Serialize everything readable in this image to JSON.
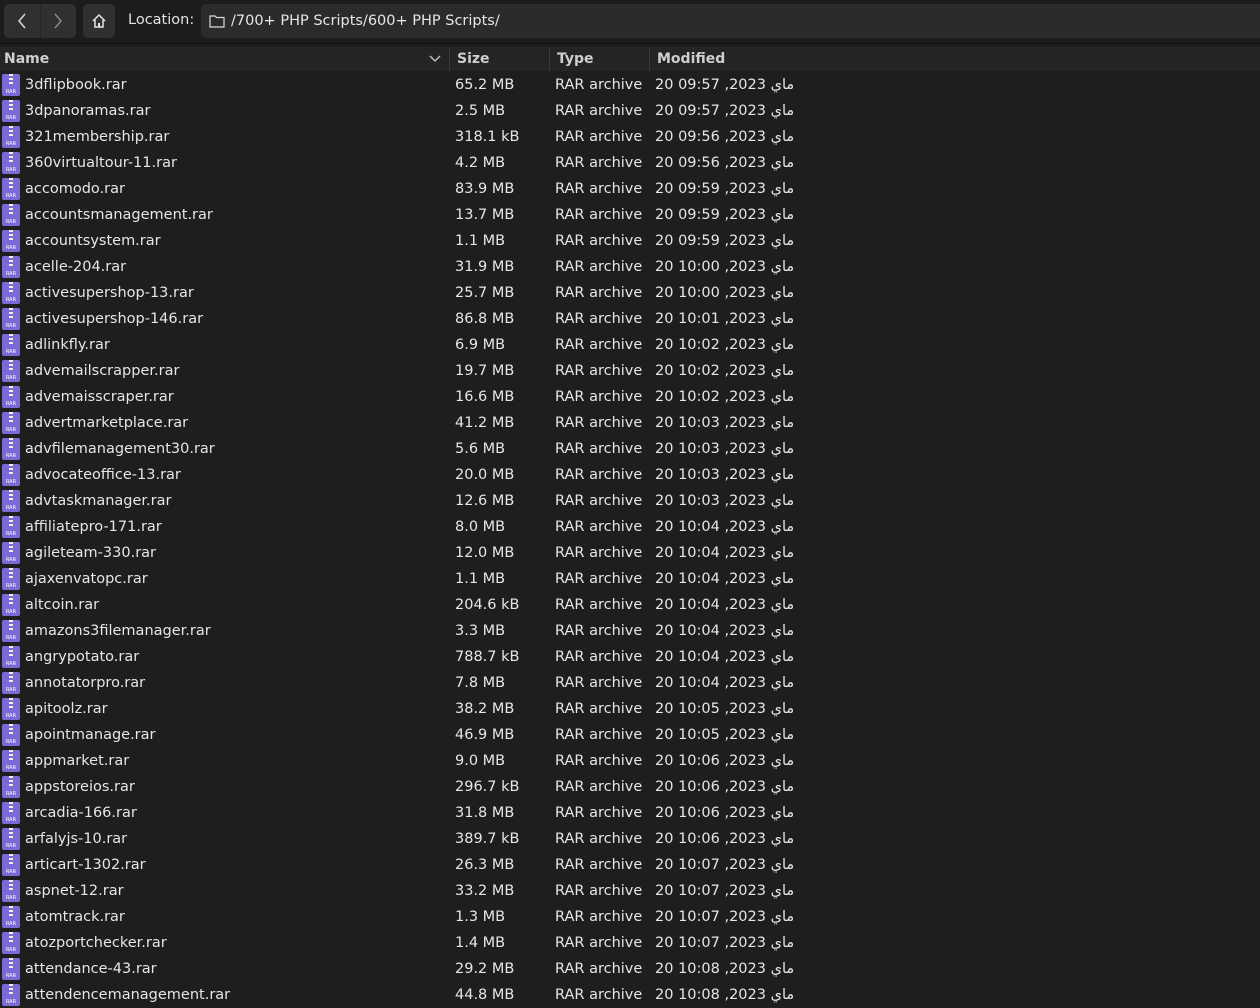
{
  "toolbar": {
    "back_icon": "chevron-left-icon",
    "forward_icon": "chevron-right-icon",
    "home_icon": "home-icon",
    "location_label": "Location:",
    "location_path": "/700+ PHP Scripts/600+ PHP Scripts/"
  },
  "columns": {
    "name": "Name",
    "size": "Size",
    "type": "Type",
    "modified": "Modified"
  },
  "colors": {
    "background": "#1e1e1e",
    "icon_rar": "#7a6ad6"
  },
  "files": [
    {
      "name": "3dflipbook.rar",
      "size": "65.2 MB",
      "type": "RAR archive",
      "modified": "20 ماي 2023, 09:57"
    },
    {
      "name": "3dpanoramas.rar",
      "size": "2.5 MB",
      "type": "RAR archive",
      "modified": "20 ماي 2023, 09:57"
    },
    {
      "name": "321membership.rar",
      "size": "318.1 kB",
      "type": "RAR archive",
      "modified": "20 ماي 2023, 09:56"
    },
    {
      "name": "360virtualtour-11.rar",
      "size": "4.2 MB",
      "type": "RAR archive",
      "modified": "20 ماي 2023, 09:56"
    },
    {
      "name": "accomodo.rar",
      "size": "83.9 MB",
      "type": "RAR archive",
      "modified": "20 ماي 2023, 09:59"
    },
    {
      "name": "accountsmanagement.rar",
      "size": "13.7 MB",
      "type": "RAR archive",
      "modified": "20 ماي 2023, 09:59"
    },
    {
      "name": "accountsystem.rar",
      "size": "1.1 MB",
      "type": "RAR archive",
      "modified": "20 ماي 2023, 09:59"
    },
    {
      "name": "acelle-204.rar",
      "size": "31.9 MB",
      "type": "RAR archive",
      "modified": "20 ماي 2023, 10:00"
    },
    {
      "name": "activesupershop-13.rar",
      "size": "25.7 MB",
      "type": "RAR archive",
      "modified": "20 ماي 2023, 10:00"
    },
    {
      "name": "activesupershop-146.rar",
      "size": "86.8 MB",
      "type": "RAR archive",
      "modified": "20 ماي 2023, 10:01"
    },
    {
      "name": "adlinkfly.rar",
      "size": "6.9 MB",
      "type": "RAR archive",
      "modified": "20 ماي 2023, 10:02"
    },
    {
      "name": "advemailscrapper.rar",
      "size": "19.7 MB",
      "type": "RAR archive",
      "modified": "20 ماي 2023, 10:02"
    },
    {
      "name": "advemaisscraper.rar",
      "size": "16.6 MB",
      "type": "RAR archive",
      "modified": "20 ماي 2023, 10:02"
    },
    {
      "name": "advertmarketplace.rar",
      "size": "41.2 MB",
      "type": "RAR archive",
      "modified": "20 ماي 2023, 10:03"
    },
    {
      "name": "advfilemanagement30.rar",
      "size": "5.6 MB",
      "type": "RAR archive",
      "modified": "20 ماي 2023, 10:03"
    },
    {
      "name": "advocateoffice-13.rar",
      "size": "20.0 MB",
      "type": "RAR archive",
      "modified": "20 ماي 2023, 10:03"
    },
    {
      "name": "advtaskmanager.rar",
      "size": "12.6 MB",
      "type": "RAR archive",
      "modified": "20 ماي 2023, 10:03"
    },
    {
      "name": "affiliatepro-171.rar",
      "size": "8.0 MB",
      "type": "RAR archive",
      "modified": "20 ماي 2023, 10:04"
    },
    {
      "name": "agileteam-330.rar",
      "size": "12.0 MB",
      "type": "RAR archive",
      "modified": "20 ماي 2023, 10:04"
    },
    {
      "name": "ajaxenvatopc.rar",
      "size": "1.1 MB",
      "type": "RAR archive",
      "modified": "20 ماي 2023, 10:04"
    },
    {
      "name": "altcoin.rar",
      "size": "204.6 kB",
      "type": "RAR archive",
      "modified": "20 ماي 2023, 10:04"
    },
    {
      "name": "amazons3filemanager.rar",
      "size": "3.3 MB",
      "type": "RAR archive",
      "modified": "20 ماي 2023, 10:04"
    },
    {
      "name": "angrypotato.rar",
      "size": "788.7 kB",
      "type": "RAR archive",
      "modified": "20 ماي 2023, 10:04"
    },
    {
      "name": "annotatorpro.rar",
      "size": "7.8 MB",
      "type": "RAR archive",
      "modified": "20 ماي 2023, 10:04"
    },
    {
      "name": "apitoolz.rar",
      "size": "38.2 MB",
      "type": "RAR archive",
      "modified": "20 ماي 2023, 10:05"
    },
    {
      "name": "apointmanage.rar",
      "size": "46.9 MB",
      "type": "RAR archive",
      "modified": "20 ماي 2023, 10:05"
    },
    {
      "name": "appmarket.rar",
      "size": "9.0 MB",
      "type": "RAR archive",
      "modified": "20 ماي 2023, 10:06"
    },
    {
      "name": "appstoreios.rar",
      "size": "296.7 kB",
      "type": "RAR archive",
      "modified": "20 ماي 2023, 10:06"
    },
    {
      "name": "arcadia-166.rar",
      "size": "31.8 MB",
      "type": "RAR archive",
      "modified": "20 ماي 2023, 10:06"
    },
    {
      "name": "arfalyjs-10.rar",
      "size": "389.7 kB",
      "type": "RAR archive",
      "modified": "20 ماي 2023, 10:06"
    },
    {
      "name": "articart-1302.rar",
      "size": "26.3 MB",
      "type": "RAR archive",
      "modified": "20 ماي 2023, 10:07"
    },
    {
      "name": "aspnet-12.rar",
      "size": "33.2 MB",
      "type": "RAR archive",
      "modified": "20 ماي 2023, 10:07"
    },
    {
      "name": "atomtrack.rar",
      "size": "1.3 MB",
      "type": "RAR archive",
      "modified": "20 ماي 2023, 10:07"
    },
    {
      "name": "atozportchecker.rar",
      "size": "1.4 MB",
      "type": "RAR archive",
      "modified": "20 ماي 2023, 10:07"
    },
    {
      "name": "attendance-43.rar",
      "size": "29.2 MB",
      "type": "RAR archive",
      "modified": "20 ماي 2023, 10:08"
    },
    {
      "name": "attendencemanagement.rar",
      "size": "44.8 MB",
      "type": "RAR archive",
      "modified": "20 ماي 2023, 10:08"
    }
  ]
}
